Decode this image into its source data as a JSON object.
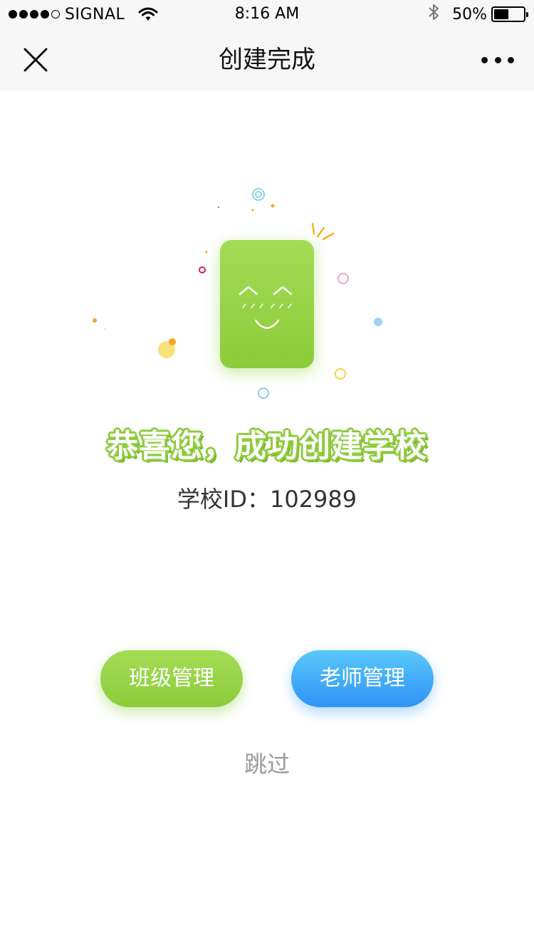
{
  "status_bar": {
    "carrier": "SIGNAL",
    "time": "8:16 AM",
    "battery_percent": "50%",
    "battery_level": 0.5,
    "icons": [
      "signal-dots-icon",
      "wifi-icon",
      "bluetooth-icon",
      "battery-icon"
    ]
  },
  "nav": {
    "title": "创建完成",
    "close_icon": "close-icon",
    "more_icon": "more-icon"
  },
  "main": {
    "headline": "恭喜您，成功创建学校",
    "school_id_label": "学校ID：",
    "school_id_value": "102989"
  },
  "actions": {
    "class_management": "班级管理",
    "teacher_management": "老师管理",
    "skip": "跳过"
  },
  "colors": {
    "green": "#8ccb3a",
    "blue": "#2f93f5",
    "gray_text": "#999999"
  }
}
